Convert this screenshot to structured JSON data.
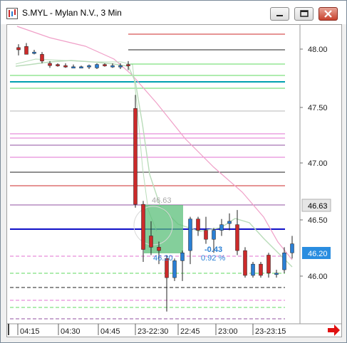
{
  "window": {
    "title": "S.MYL - Mylan N.V., 3 Min",
    "minimize_icon": "minimize-icon",
    "maximize_icon": "maximize-icon",
    "close_icon": "close-icon"
  },
  "chart": {
    "colors": {
      "up": "#2a7fd5",
      "down": "#cc2a2a",
      "price_label_bg": "#e6e6e6",
      "current_price_bg": "#2a8de0",
      "measure_box": "#5bbf7a",
      "sma_pink": "#f0a0c8",
      "sma_green": "#b9dcb9",
      "blue_level": "#1010c8",
      "teal_level": "#00a0b0"
    },
    "price_labels": [
      "48.00",
      "47.50",
      "47.00",
      "46.50",
      "46.00"
    ],
    "tagged_prices": {
      "last_close": "46.63",
      "current": "46.20"
    },
    "time_labels": [
      "04:15",
      "04:30",
      "04:45",
      "23-22:30",
      "22:45",
      "23:00",
      "23-23:15"
    ],
    "annotations": {
      "high_value": "46.63",
      "low_value": "46.20",
      "change_value": "-0.43",
      "change_percent": "0.92 %"
    },
    "nav_arrow_icon": "right-arrow-icon"
  },
  "chart_data": {
    "type": "candlestick",
    "title": "S.MYL - Mylan N.V., 3 Min",
    "ylim": [
      45.7,
      48.2
    ],
    "grid": false,
    "price_axis": [
      48.0,
      47.5,
      47.0,
      46.5,
      46.0
    ],
    "time_axis": [
      "04:15",
      "04:30",
      "04:45",
      "23-22:30",
      "22:45",
      "23:00",
      "23-23:15"
    ],
    "candles": [
      {
        "open": 48.02,
        "high": 48.05,
        "low": 47.95,
        "close": 48.0
      },
      {
        "open": 48.03,
        "high": 48.06,
        "low": 47.96,
        "close": 47.96
      },
      {
        "open": 47.98,
        "high": 48.0,
        "low": 47.96,
        "close": 47.98
      },
      {
        "open": 47.96,
        "high": 47.98,
        "low": 47.88,
        "close": 47.9
      },
      {
        "open": 47.88,
        "high": 47.9,
        "low": 47.84,
        "close": 47.86
      },
      {
        "open": 47.87,
        "high": 47.88,
        "low": 47.85,
        "close": 47.86
      },
      {
        "open": 47.86,
        "high": 47.88,
        "low": 47.84,
        "close": 47.85
      },
      {
        "open": 47.85,
        "high": 47.87,
        "low": 47.84,
        "close": 47.85
      },
      {
        "open": 47.85,
        "high": 47.86,
        "low": 47.84,
        "close": 47.85
      },
      {
        "open": 47.85,
        "high": 47.87,
        "low": 47.83,
        "close": 47.86
      },
      {
        "open": 47.84,
        "high": 47.88,
        "low": 47.83,
        "close": 47.87
      },
      {
        "open": 47.87,
        "high": 47.88,
        "low": 47.85,
        "close": 47.86
      },
      {
        "open": 47.85,
        "high": 47.88,
        "low": 47.84,
        "close": 47.86
      },
      {
        "open": 47.85,
        "high": 47.88,
        "low": 47.83,
        "close": 47.86
      },
      {
        "open": 47.87,
        "high": 47.9,
        "low": 47.82,
        "close": 47.86
      },
      {
        "open": 47.48,
        "high": 47.6,
        "low": 46.6,
        "close": 46.63
      },
      {
        "open": 46.63,
        "high": 46.66,
        "low": 46.12,
        "close": 46.23
      },
      {
        "open": 46.35,
        "high": 46.48,
        "low": 46.18,
        "close": 46.25
      },
      {
        "open": 46.25,
        "high": 46.3,
        "low": 46.1,
        "close": 46.22
      },
      {
        "open": 46.15,
        "high": 46.18,
        "low": 45.68,
        "close": 45.98
      },
      {
        "open": 45.98,
        "high": 46.15,
        "low": 45.95,
        "close": 46.13
      },
      {
        "open": 46.13,
        "high": 46.22,
        "low": 45.95,
        "close": 46.2
      },
      {
        "open": 46.22,
        "high": 46.52,
        "low": 46.1,
        "close": 46.5
      },
      {
        "open": 46.5,
        "high": 46.52,
        "low": 46.35,
        "close": 46.4
      },
      {
        "open": 46.4,
        "high": 46.52,
        "low": 46.28,
        "close": 46.32
      },
      {
        "open": 46.32,
        "high": 46.42,
        "low": 46.2,
        "close": 46.4
      },
      {
        "open": 46.4,
        "high": 46.5,
        "low": 46.35,
        "close": 46.45
      },
      {
        "open": 46.46,
        "high": 46.55,
        "low": 46.4,
        "close": 46.48
      },
      {
        "open": 46.45,
        "high": 46.58,
        "low": 46.18,
        "close": 46.22
      },
      {
        "open": 46.22,
        "high": 46.25,
        "low": 45.98,
        "close": 46.0
      },
      {
        "open": 46.0,
        "high": 46.12,
        "low": 45.98,
        "close": 46.1
      },
      {
        "open": 46.1,
        "high": 46.12,
        "low": 45.98,
        "close": 46.0
      },
      {
        "open": 46.18,
        "high": 46.2,
        "low": 45.98,
        "close": 46.02
      },
      {
        "open": 46.02,
        "high": 46.05,
        "low": 45.98,
        "close": 46.02
      },
      {
        "open": 46.05,
        "high": 46.25,
        "low": 46.02,
        "close": 46.2
      },
      {
        "open": 46.2,
        "high": 46.35,
        "low": 46.15,
        "close": 46.28
      }
    ]
  }
}
